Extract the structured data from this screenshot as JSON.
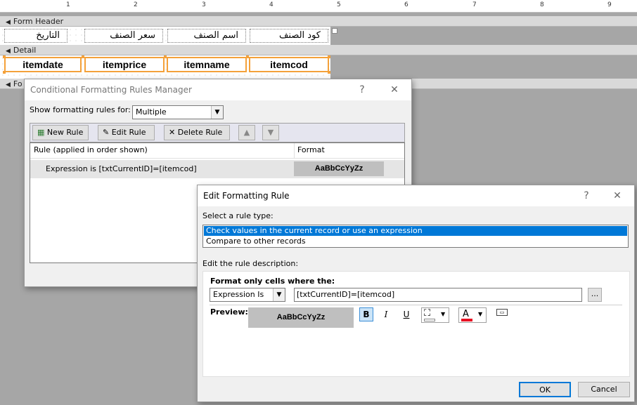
{
  "ruler": {
    "numbers": [
      "1",
      "2",
      "3",
      "4",
      "5",
      "6",
      "7",
      "8",
      "9"
    ]
  },
  "design": {
    "form_header_label": "Form Header",
    "detail_label": "Detail",
    "footer_label": "Fo",
    "header_labels": [
      "التاريخ",
      "سعر الصنف",
      "اسم الصنف",
      "كود الصنف"
    ],
    "detail_fields": [
      "itemdate",
      "itemprice",
      "itemname",
      "itemcod"
    ]
  },
  "manager": {
    "title": "Conditional Formatting Rules Manager",
    "help": "?",
    "close": "✕",
    "show_rules_label": "Show formatting rules for:",
    "show_rules_value": "Multiple",
    "new_rule": "New Rule",
    "edit_rule": "Edit Rule",
    "delete_rule": "Delete Rule",
    "col_rule": "Rule (applied in order shown)",
    "col_format": "Format",
    "rules": [
      {
        "rule": "Expression is [txtCurrentID]=[itemcod]",
        "format": "AaBbCcYyZz"
      }
    ]
  },
  "edit": {
    "title": "Edit Formatting Rule",
    "help": "?",
    "close": "✕",
    "select_type_label": "Select a rule type:",
    "rule_types": [
      "Check values in the current record or use an expression",
      "Compare to other records"
    ],
    "selected_type_index": 0,
    "edit_desc_label": "Edit the rule description:",
    "format_only_label": "Format only cells where the:",
    "condition_value": "Expression Is",
    "expression_value": "[txtCurrentID]=[itemcod]",
    "ellipsis": "...",
    "preview_label": "Preview:",
    "preview_text": "AaBbCcYyZz",
    "bold": "B",
    "italic": "I",
    "underline": "U",
    "font_color_letter": "A",
    "ok": "OK",
    "cancel": "Cancel"
  },
  "colors": {
    "selection": "#0078d7",
    "field_border": "#f4a13a",
    "preview_bg": "#bfbfbf",
    "font_color_bar": "#e81123"
  }
}
